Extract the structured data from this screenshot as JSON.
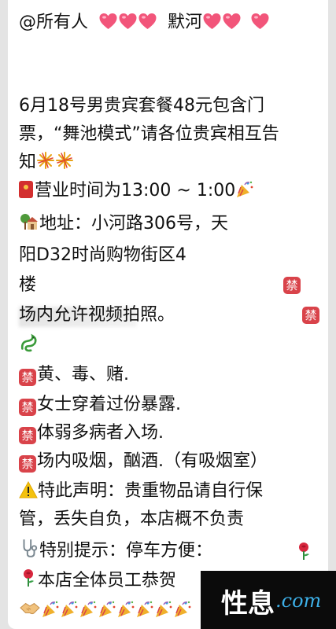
{
  "message": {
    "line1_mention": "@所有人",
    "line1_name": "默河",
    "line3": "6月18号男贵宾套餐48元包含门",
    "line4": "票，“舞池模式”请各位贵宾相互告",
    "line5": "知",
    "line6": "营业时间为13:00 ~ 1:00",
    "line7": "地址：小河路306号，天",
    "line8": "阳D32时尚购物街区4",
    "line9": "楼",
    "line10": "场内允许视频拍照。",
    "ban_char": "禁",
    "ban1": "黄、毒、赌.",
    "ban2": "女士穿着过份暴露.",
    "ban3": "体弱多病者入场.",
    "ban4": "场内吸烟，酗酒.（有吸烟室）",
    "notice1": "特此声明：贵重物品请自行保",
    "notice2": "管，丢失自负，本店概不负责",
    "notice3": "特别提示：停车方便：",
    "notice4": "本店全体员工恭贺"
  },
  "watermark": {
    "cn": "性息",
    "com": ".com"
  },
  "colors": {
    "heart": "#f2557a",
    "ban": "#d9434a",
    "watermark_blue": "#3db0e8"
  },
  "icons": [
    "heart-icon",
    "fireworks-icon",
    "red-envelope-icon",
    "party-popper-icon",
    "house-icon",
    "ban-icon",
    "dragon-icon",
    "warning-icon",
    "stethoscope-icon",
    "rose-icon",
    "handshake-icon"
  ]
}
